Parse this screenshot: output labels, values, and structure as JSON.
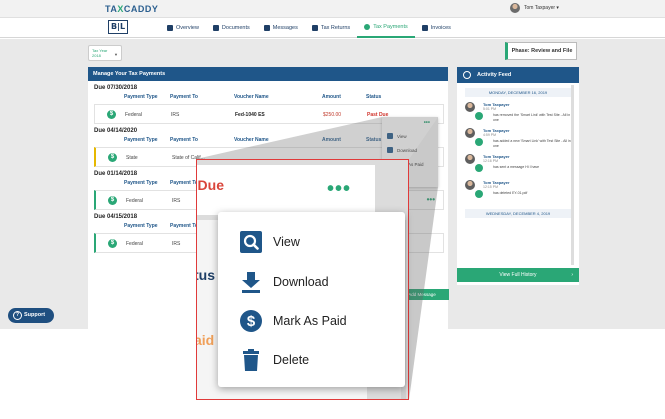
{
  "brand": {
    "logo_prefix": "TA",
    "logo_x": "X",
    "logo_suffix": "CADDY",
    "workspace_logo": "B|L"
  },
  "user": {
    "name": "Tom Taxpayer ▾"
  },
  "nav": [
    {
      "label": "Overview",
      "icon": "home-icon"
    },
    {
      "label": "Documents",
      "icon": "documents-icon"
    },
    {
      "label": "Messages",
      "icon": "messages-icon"
    },
    {
      "label": "Tax Returns",
      "icon": "tax-returns-icon"
    },
    {
      "label": "Tax Payments",
      "icon": "dollar-icon",
      "active": true
    },
    {
      "label": "Invoices",
      "icon": "invoices-icon"
    }
  ],
  "tax_year": {
    "label": "Tax Year",
    "value": "2018"
  },
  "phase_button": "Phase: Review and File",
  "payments": {
    "title": "Manage Your Tax Payments",
    "columns": [
      "Payment Type",
      "Payment To",
      "Voucher Name",
      "Amount",
      "Status"
    ],
    "groups": [
      {
        "due": "Due 07/30/2018",
        "type": "Federal",
        "to": "IRS",
        "voucher": "Fed-1040 ES",
        "amount": "$250.00",
        "status": "Past Due"
      },
      {
        "due": "Due 04/14/2020",
        "type": "State",
        "to": "State of Calif..."
      },
      {
        "due": "Due 01/14/2018",
        "type": "Federal",
        "to": "IRS"
      },
      {
        "due": "Due 04/15/2018",
        "type": "Federal",
        "to": "IRS"
      }
    ],
    "add_message": "Add Message"
  },
  "small_menu": [
    "View",
    "Download",
    "Mark As Paid"
  ],
  "feed": {
    "title": "Activity Feed",
    "dates": [
      "MONDAY, DECEMBER 16, 2019",
      "WEDNESDAY, DECEMBER 4, 2019"
    ],
    "entries": [
      {
        "who": "Tom Taxpayer",
        "when": "5:01 PM",
        "what": "has removed the 'Smart Link' with Test Site - All in one"
      },
      {
        "who": "Tom Taxpayer",
        "when": "4:59 PM",
        "what": "has added a new 'Smart Link' with Test Site - All in one"
      },
      {
        "who": "Tom Taxpayer",
        "when": "12:16 PM",
        "what": "has sent a message Hi I have"
      },
      {
        "who": "Tom Taxpayer",
        "when": "12:15 PM",
        "what": "has deleted EY-01.pdf"
      }
    ],
    "footer": "View Full History"
  },
  "support": "Support",
  "zoom": {
    "status_partial": "t Due",
    "dots": "•••",
    "status_partial2": "tus",
    "paid_partial": "aid"
  },
  "actions": [
    {
      "label": "View",
      "icon": "view-search-icon"
    },
    {
      "label": "Download",
      "icon": "download-icon"
    },
    {
      "label": "Mark As Paid",
      "icon": "dollar-circle-icon"
    },
    {
      "label": "Delete",
      "icon": "trash-icon"
    }
  ],
  "colors": {
    "navy": "#1f5689",
    "green": "#2aa776",
    "red": "#d9453b",
    "highlight": "#e03a3a"
  }
}
